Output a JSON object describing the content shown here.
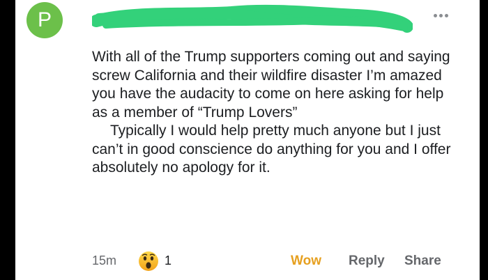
{
  "colors": {
    "avatar_bg": "#6cc04a",
    "redaction": "#33d17a",
    "wow": "#e6a020",
    "muted": "#65676b",
    "text": "#1c1e21"
  },
  "comment": {
    "author_initial": "P",
    "paragraphs": [
      "With all of the Trump supporters coming out and saying screw California and their wildfire disaster I’m amazed you have the audacity to come on here asking for help as a member of “Trump Lovers”",
      "Typically I would help pretty much anyone but I just can’t in good conscience do anything for you and I offer absolutely no apology for it."
    ],
    "more_icon": "more-horizontal-icon"
  },
  "footer": {
    "time": "15m",
    "reaction_icon": "wow-emoji-icon",
    "reaction_count": "1",
    "wow_label": "Wow",
    "reply_label": "Reply",
    "share_label": "Share"
  }
}
